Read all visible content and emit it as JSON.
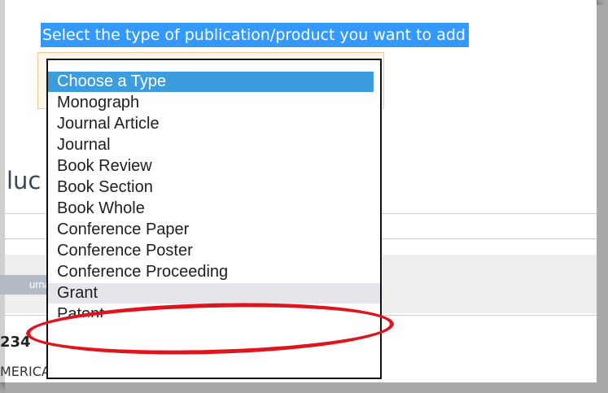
{
  "prompt": "Select the type of publication/product you want to add",
  "type_select": {
    "options": [
      "Choose a Type",
      "Monograph",
      "Journal Article",
      "Journal",
      "Book Review",
      "Book Section",
      "Book Whole",
      "Conference Paper",
      "Conference Poster",
      "Conference Proceeding",
      "Grant",
      "Patent"
    ],
    "selected": "Choose a Type",
    "hovered": "Grant"
  },
  "background": {
    "heading_fragment": "luc",
    "badge_fragment": "urna",
    "number_fragment": "234",
    "country_fragment": "MERICA ()"
  },
  "colors": {
    "highlight": "#3399ff",
    "selected_option": "#3b9ddd",
    "annotation": "#e0141c"
  }
}
